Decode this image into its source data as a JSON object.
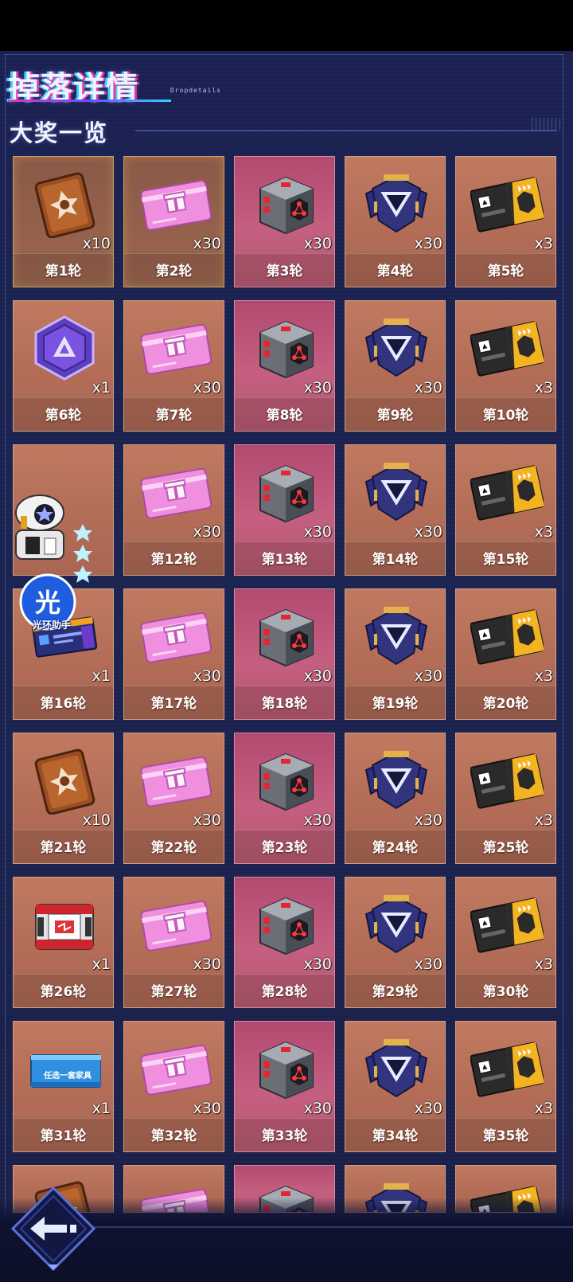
{
  "header": {
    "title": "掉落详情",
    "subtitle": "Dropdetails",
    "section_title": "大奖一览"
  },
  "overlay": {
    "assistant_label": "光环助手",
    "assistant_glyph": "光"
  },
  "colors": {
    "card_bg": "#b36d57",
    "card_pink_bg": "#c55f80",
    "panel_bg": "#1b2350",
    "accent": "#3ad2ff"
  },
  "rewards": [
    {
      "round": "第1轮",
      "qty": "x10",
      "icon": "bronze-card-icon",
      "highlight": true
    },
    {
      "round": "第2轮",
      "qty": "x30",
      "icon": "pink-gift-ticket-icon",
      "highlight": true
    },
    {
      "round": "第3轮",
      "qty": "x30",
      "icon": "metal-crate-icon",
      "pink": true
    },
    {
      "round": "第4轮",
      "qty": "x30",
      "icon": "triangle-core-icon"
    },
    {
      "round": "第5轮",
      "qty": "x3",
      "icon": "gold-ticket-icon"
    },
    {
      "round": "第6轮",
      "qty": "x1",
      "icon": "purple-hex-badge-icon"
    },
    {
      "round": "第7轮",
      "qty": "x30",
      "icon": "pink-gift-ticket-icon"
    },
    {
      "round": "第8轮",
      "qty": "x30",
      "icon": "metal-crate-icon",
      "pink": true
    },
    {
      "round": "第9轮",
      "qty": "x30",
      "icon": "triangle-core-icon"
    },
    {
      "round": "第10轮",
      "qty": "x3",
      "icon": "gold-ticket-icon"
    },
    {
      "round": "",
      "qty": "",
      "icon": "",
      "covered": true
    },
    {
      "round": "第12轮",
      "qty": "x30",
      "icon": "pink-gift-ticket-icon"
    },
    {
      "round": "第13轮",
      "qty": "x30",
      "icon": "metal-crate-icon",
      "pink": true
    },
    {
      "round": "第14轮",
      "qty": "x30",
      "icon": "triangle-core-icon"
    },
    {
      "round": "第15轮",
      "qty": "x3",
      "icon": "gold-ticket-icon"
    },
    {
      "round": "第16轮",
      "qty": "x1",
      "icon": "blue-card-icon"
    },
    {
      "round": "第17轮",
      "qty": "x30",
      "icon": "pink-gift-ticket-icon"
    },
    {
      "round": "第18轮",
      "qty": "x30",
      "icon": "metal-crate-icon",
      "pink": true
    },
    {
      "round": "第19轮",
      "qty": "x30",
      "icon": "triangle-core-icon"
    },
    {
      "round": "第20轮",
      "qty": "x3",
      "icon": "gold-ticket-icon"
    },
    {
      "round": "第21轮",
      "qty": "x10",
      "icon": "bronze-card-icon"
    },
    {
      "round": "第22轮",
      "qty": "x30",
      "icon": "pink-gift-ticket-icon"
    },
    {
      "round": "第23轮",
      "qty": "x30",
      "icon": "metal-crate-icon",
      "pink": true
    },
    {
      "round": "第24轮",
      "qty": "x30",
      "icon": "triangle-core-icon"
    },
    {
      "round": "第25轮",
      "qty": "x3",
      "icon": "gold-ticket-icon"
    },
    {
      "round": "第26轮",
      "qty": "x1",
      "icon": "red-chest-icon"
    },
    {
      "round": "第27轮",
      "qty": "x30",
      "icon": "pink-gift-ticket-icon"
    },
    {
      "round": "第28轮",
      "qty": "x30",
      "icon": "metal-crate-icon",
      "pink": true
    },
    {
      "round": "第29轮",
      "qty": "x30",
      "icon": "triangle-core-icon"
    },
    {
      "round": "第30轮",
      "qty": "x3",
      "icon": "gold-ticket-icon"
    },
    {
      "round": "第31轮",
      "qty": "x1",
      "icon": "blue-select-ticket-icon",
      "ticket_text": "任选一套家具"
    },
    {
      "round": "第32轮",
      "qty": "x30",
      "icon": "pink-gift-ticket-icon"
    },
    {
      "round": "第33轮",
      "qty": "x30",
      "icon": "metal-crate-icon",
      "pink": true
    },
    {
      "round": "第34轮",
      "qty": "x30",
      "icon": "triangle-core-icon"
    },
    {
      "round": "第35轮",
      "qty": "x3",
      "icon": "gold-ticket-icon"
    },
    {
      "round": "",
      "qty": "",
      "icon": "bronze-card-icon",
      "partial": true
    },
    {
      "round": "",
      "qty": "",
      "icon": "pink-gift-ticket-icon",
      "partial": true
    },
    {
      "round": "",
      "qty": "",
      "icon": "metal-crate-icon",
      "pink": true,
      "partial": true
    },
    {
      "round": "",
      "qty": "",
      "icon": "triangle-core-icon",
      "partial": true
    },
    {
      "round": "",
      "qty": "",
      "icon": "gold-ticket-icon",
      "partial": true
    }
  ]
}
